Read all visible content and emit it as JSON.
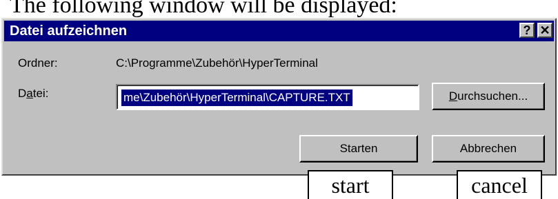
{
  "doc_caption": "The following window will be displayed:",
  "window": {
    "title": "Datei aufzeichnen",
    "help_label": "?",
    "close_label": "✕"
  },
  "form": {
    "folder_label": "Ordner:",
    "folder_value": "C:\\Programme\\Zubehör\\HyperTerminal",
    "file_label_pre": "D",
    "file_label_ul": "a",
    "file_label_post": "tei:",
    "file_value": "me\\Zubehör\\HyperTerminal\\CAPTURE.TXT"
  },
  "buttons": {
    "browse_ul": "D",
    "browse_rest": "urchsuchen...",
    "start": "Starten",
    "cancel": "Abbrechen"
  },
  "callouts": {
    "start": "start",
    "cancel": "cancel"
  }
}
